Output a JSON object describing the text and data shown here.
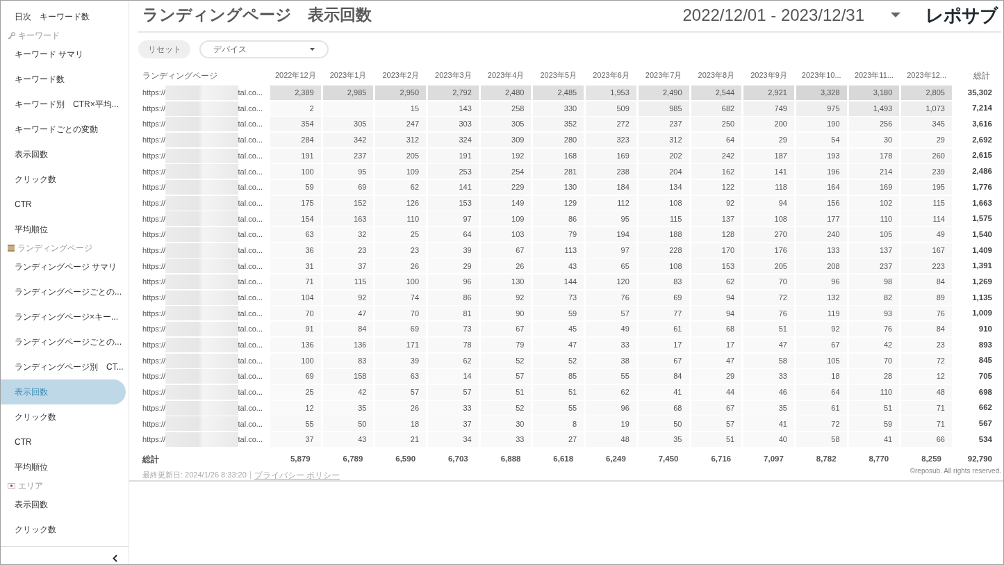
{
  "sidebar": {
    "groups": [
      {
        "items": [
          {
            "label": "日次　キーワード数",
            "selected": false
          }
        ]
      },
      {
        "header": "キーワード",
        "items": [
          {
            "label": "キーワード サマリ",
            "selected": false
          },
          {
            "label": "キーワード数",
            "selected": false
          },
          {
            "label": "キーワード別　CTR×平均...",
            "selected": false
          },
          {
            "label": "キーワードごとの変動",
            "selected": false
          },
          {
            "label": "表示回数",
            "selected": false
          },
          {
            "label": "クリック数",
            "selected": false
          },
          {
            "label": "CTR",
            "selected": false
          },
          {
            "label": "平均順位",
            "selected": false
          }
        ]
      },
      {
        "header": "ランディングページ",
        "items": [
          {
            "label": "ランディングページ サマリ",
            "selected": false
          },
          {
            "label": "ランディングページごとの...",
            "selected": false
          },
          {
            "label": "ランディングページ×キー...",
            "selected": false
          },
          {
            "label": "ランディングページごとの...",
            "selected": false
          },
          {
            "label": "ランディングページ別　CT...",
            "selected": false
          },
          {
            "label": "表示回数",
            "selected": true
          },
          {
            "label": "クリック数",
            "selected": false
          },
          {
            "label": "CTR",
            "selected": false
          },
          {
            "label": "平均順位",
            "selected": false
          }
        ]
      },
      {
        "header": "エリア",
        "items": [
          {
            "label": "表示回数",
            "selected": false
          },
          {
            "label": "クリック数",
            "selected": false
          }
        ]
      }
    ]
  },
  "header": {
    "title": "ランディングページ　表示回数",
    "date_range": "2022/12/01 - 2023/12/31",
    "logo": "レポサブ"
  },
  "filters": {
    "reset_button": "リセット",
    "device_dropdown": {
      "label": "デバイス"
    }
  },
  "table": {
    "columns": [
      "ランディングページ",
      "2022年12月",
      "2023年1月",
      "2023年2月",
      "2023年3月",
      "2023年4月",
      "2023年5月",
      "2023年6月",
      "2023年7月",
      "2023年8月",
      "2023年9月",
      "2023年10...",
      "2023年11...",
      "2023年12...",
      "総計"
    ],
    "rows": [
      {
        "cells": [
          {
            "url_start": "https://",
            "url_end": "tal.co..."
          },
          {
            "value": "2,389"
          },
          {
            "value": "2,985"
          },
          {
            "value": "2,950"
          },
          {
            "value": "2,792"
          },
          {
            "value": "2,480"
          },
          {
            "value": "2,485"
          },
          {
            "value": "1,953"
          },
          {
            "value": "2,490"
          },
          {
            "value": "2,544"
          },
          {
            "value": "2,921"
          },
          {
            "value": "3,328"
          },
          {
            "value": "3,180"
          },
          {
            "value": "2,805"
          },
          {
            "value": "35,302"
          }
        ]
      },
      {
        "cells": [
          {
            "url_start": "https://",
            "url_end": "tal.co..."
          },
          {
            "value": "2"
          },
          {},
          {
            "value": "15"
          },
          {
            "value": "143"
          },
          {
            "value": "258"
          },
          {
            "value": "330"
          },
          {
            "value": "509"
          },
          {
            "value": "985"
          },
          {
            "value": "682"
          },
          {
            "value": "749"
          },
          {
            "value": "975"
          },
          {
            "value": "1,493"
          },
          {
            "value": "1,073"
          },
          {
            "value": "7,214"
          }
        ]
      },
      {
        "cells": [
          {
            "url_start": "https://",
            "url_end": "tal.co..."
          },
          {
            "value": "354"
          },
          {
            "value": "305"
          },
          {
            "value": "247"
          },
          {
            "value": "303"
          },
          {
            "value": "305"
          },
          {
            "value": "352"
          },
          {
            "value": "272"
          },
          {
            "value": "237"
          },
          {
            "value": "250"
          },
          {
            "value": "200"
          },
          {
            "value": "190"
          },
          {
            "value": "256"
          },
          {
            "value": "345"
          },
          {
            "value": "3,616"
          }
        ]
      },
      {
        "cells": [
          {
            "url_start": "https://",
            "url_end": "tal.co..."
          },
          {
            "value": "284"
          },
          {
            "value": "342"
          },
          {
            "value": "312"
          },
          {
            "value": "324"
          },
          {
            "value": "309"
          },
          {
            "value": "280"
          },
          {
            "value": "323"
          },
          {
            "value": "312"
          },
          {
            "value": "64"
          },
          {
            "value": "29"
          },
          {
            "value": "54"
          },
          {
            "value": "30"
          },
          {
            "value": "29"
          },
          {
            "value": "2,692"
          }
        ]
      },
      {
        "cells": [
          {
            "url_start": "https://",
            "url_end": "tal.co..."
          },
          {
            "value": "191"
          },
          {
            "value": "237"
          },
          {
            "value": "205"
          },
          {
            "value": "191"
          },
          {
            "value": "192"
          },
          {
            "value": "168"
          },
          {
            "value": "169"
          },
          {
            "value": "202"
          },
          {
            "value": "242"
          },
          {
            "value": "187"
          },
          {
            "value": "193"
          },
          {
            "value": "178"
          },
          {
            "value": "260"
          },
          {
            "value": "2,615"
          }
        ]
      },
      {
        "cells": [
          {
            "url_start": "https://",
            "url_end": "tal.co..."
          },
          {
            "value": "100"
          },
          {
            "value": "95"
          },
          {
            "value": "109"
          },
          {
            "value": "253"
          },
          {
            "value": "254"
          },
          {
            "value": "281"
          },
          {
            "value": "238"
          },
          {
            "value": "204"
          },
          {
            "value": "162"
          },
          {
            "value": "141"
          },
          {
            "value": "196"
          },
          {
            "value": "214"
          },
          {
            "value": "239"
          },
          {
            "value": "2,486"
          }
        ]
      },
      {
        "cells": [
          {
            "url_start": "https://",
            "url_end": "tal.co..."
          },
          {
            "value": "59"
          },
          {
            "value": "69"
          },
          {
            "value": "62"
          },
          {
            "value": "141"
          },
          {
            "value": "229"
          },
          {
            "value": "130"
          },
          {
            "value": "184"
          },
          {
            "value": "134"
          },
          {
            "value": "122"
          },
          {
            "value": "118"
          },
          {
            "value": "164"
          },
          {
            "value": "169"
          },
          {
            "value": "195"
          },
          {
            "value": "1,776"
          }
        ]
      },
      {
        "cells": [
          {
            "url_start": "https://",
            "url_end": "tal.co..."
          },
          {
            "value": "175"
          },
          {
            "value": "152"
          },
          {
            "value": "126"
          },
          {
            "value": "153"
          },
          {
            "value": "149"
          },
          {
            "value": "129"
          },
          {
            "value": "112"
          },
          {
            "value": "108"
          },
          {
            "value": "92"
          },
          {
            "value": "94"
          },
          {
            "value": "156"
          },
          {
            "value": "102"
          },
          {
            "value": "115"
          },
          {
            "value": "1,663"
          }
        ]
      },
      {
        "cells": [
          {
            "url_start": "https://",
            "url_end": "tal.co..."
          },
          {
            "value": "154"
          },
          {
            "value": "163"
          },
          {
            "value": "110"
          },
          {
            "value": "97"
          },
          {
            "value": "109"
          },
          {
            "value": "86"
          },
          {
            "value": "95"
          },
          {
            "value": "115"
          },
          {
            "value": "137"
          },
          {
            "value": "108"
          },
          {
            "value": "177"
          },
          {
            "value": "110"
          },
          {
            "value": "114"
          },
          {
            "value": "1,575"
          }
        ]
      },
      {
        "cells": [
          {
            "url_start": "https://",
            "url_end": "tal.co..."
          },
          {
            "value": "63"
          },
          {
            "value": "32"
          },
          {
            "value": "25"
          },
          {
            "value": "64"
          },
          {
            "value": "103"
          },
          {
            "value": "79"
          },
          {
            "value": "194"
          },
          {
            "value": "188"
          },
          {
            "value": "128"
          },
          {
            "value": "270"
          },
          {
            "value": "240"
          },
          {
            "value": "105"
          },
          {
            "value": "49"
          },
          {
            "value": "1,540"
          }
        ]
      },
      {
        "cells": [
          {
            "url_start": "https://",
            "url_end": "tal.co..."
          },
          {
            "value": "36"
          },
          {
            "value": "23"
          },
          {
            "value": "23"
          },
          {
            "value": "39"
          },
          {
            "value": "67"
          },
          {
            "value": "113"
          },
          {
            "value": "97"
          },
          {
            "value": "228"
          },
          {
            "value": "170"
          },
          {
            "value": "176"
          },
          {
            "value": "133"
          },
          {
            "value": "137"
          },
          {
            "value": "167"
          },
          {
            "value": "1,409"
          }
        ]
      },
      {
        "cells": [
          {
            "url_start": "https://",
            "url_end": "tal.co..."
          },
          {
            "value": "31"
          },
          {
            "value": "37"
          },
          {
            "value": "26"
          },
          {
            "value": "29"
          },
          {
            "value": "26"
          },
          {
            "value": "43"
          },
          {
            "value": "65"
          },
          {
            "value": "108"
          },
          {
            "value": "153"
          },
          {
            "value": "205"
          },
          {
            "value": "208"
          },
          {
            "value": "237"
          },
          {
            "value": "223"
          },
          {
            "value": "1,391"
          }
        ]
      },
      {
        "cells": [
          {
            "url_start": "https://",
            "url_end": "tal.co..."
          },
          {
            "value": "71"
          },
          {
            "value": "115"
          },
          {
            "value": "100"
          },
          {
            "value": "96"
          },
          {
            "value": "130"
          },
          {
            "value": "144"
          },
          {
            "value": "120"
          },
          {
            "value": "83"
          },
          {
            "value": "62"
          },
          {
            "value": "70"
          },
          {
            "value": "96"
          },
          {
            "value": "98"
          },
          {
            "value": "84"
          },
          {
            "value": "1,269"
          }
        ]
      },
      {
        "cells": [
          {
            "url_start": "https://",
            "url_end": "tal.co..."
          },
          {
            "value": "104"
          },
          {
            "value": "92"
          },
          {
            "value": "74"
          },
          {
            "value": "86"
          },
          {
            "value": "92"
          },
          {
            "value": "73"
          },
          {
            "value": "76"
          },
          {
            "value": "69"
          },
          {
            "value": "94"
          },
          {
            "value": "72"
          },
          {
            "value": "132"
          },
          {
            "value": "82"
          },
          {
            "value": "89"
          },
          {
            "value": "1,135"
          }
        ]
      },
      {
        "cells": [
          {
            "url_start": "https://",
            "url_end": "tal.co..."
          },
          {
            "value": "70"
          },
          {
            "value": "47"
          },
          {
            "value": "70"
          },
          {
            "value": "81"
          },
          {
            "value": "90"
          },
          {
            "value": "59"
          },
          {
            "value": "57"
          },
          {
            "value": "77"
          },
          {
            "value": "94"
          },
          {
            "value": "76"
          },
          {
            "value": "119"
          },
          {
            "value": "93"
          },
          {
            "value": "76"
          },
          {
            "value": "1,009"
          }
        ]
      },
      {
        "cells": [
          {
            "url_start": "https://",
            "url_end": "tal.co..."
          },
          {
            "value": "91"
          },
          {
            "value": "84"
          },
          {
            "value": "69"
          },
          {
            "value": "73"
          },
          {
            "value": "67"
          },
          {
            "value": "45"
          },
          {
            "value": "49"
          },
          {
            "value": "61"
          },
          {
            "value": "68"
          },
          {
            "value": "51"
          },
          {
            "value": "92"
          },
          {
            "value": "76"
          },
          {
            "value": "84"
          },
          {
            "value": "910"
          }
        ]
      },
      {
        "cells": [
          {
            "url_start": "https://",
            "url_end": "tal.co..."
          },
          {
            "value": "136"
          },
          {
            "value": "136"
          },
          {
            "value": "171"
          },
          {
            "value": "78"
          },
          {
            "value": "79"
          },
          {
            "value": "47"
          },
          {
            "value": "33"
          },
          {
            "value": "17"
          },
          {
            "value": "17"
          },
          {
            "value": "47"
          },
          {
            "value": "67"
          },
          {
            "value": "42"
          },
          {
            "value": "23"
          },
          {
            "value": "893"
          }
        ]
      },
      {
        "cells": [
          {
            "url_start": "https://",
            "url_end": "tal.co..."
          },
          {
            "value": "100"
          },
          {
            "value": "83"
          },
          {
            "value": "39"
          },
          {
            "value": "62"
          },
          {
            "value": "52"
          },
          {
            "value": "52"
          },
          {
            "value": "38"
          },
          {
            "value": "67"
          },
          {
            "value": "47"
          },
          {
            "value": "58"
          },
          {
            "value": "105"
          },
          {
            "value": "70"
          },
          {
            "value": "72"
          },
          {
            "value": "845"
          }
        ]
      },
      {
        "cells": [
          {
            "url_start": "https://",
            "url_end": "tal.co..."
          },
          {
            "value": "69"
          },
          {
            "value": "158"
          },
          {
            "value": "63"
          },
          {
            "value": "14"
          },
          {
            "value": "57"
          },
          {
            "value": "85"
          },
          {
            "value": "55"
          },
          {
            "value": "84"
          },
          {
            "value": "29"
          },
          {
            "value": "33"
          },
          {
            "value": "18"
          },
          {
            "value": "28"
          },
          {
            "value": "12"
          },
          {
            "value": "705"
          }
        ]
      },
      {
        "cells": [
          {
            "url_start": "https://",
            "url_end": "tal.co..."
          },
          {
            "value": "25"
          },
          {
            "value": "42"
          },
          {
            "value": "57"
          },
          {
            "value": "57"
          },
          {
            "value": "51"
          },
          {
            "value": "51"
          },
          {
            "value": "62"
          },
          {
            "value": "41"
          },
          {
            "value": "44"
          },
          {
            "value": "46"
          },
          {
            "value": "64"
          },
          {
            "value": "110"
          },
          {
            "value": "48"
          },
          {
            "value": "698"
          }
        ]
      },
      {
        "cells": [
          {
            "url_start": "https://",
            "url_end": "tal.co..."
          },
          {
            "value": "12"
          },
          {
            "value": "35"
          },
          {
            "value": "26"
          },
          {
            "value": "33"
          },
          {
            "value": "52"
          },
          {
            "value": "55"
          },
          {
            "value": "96"
          },
          {
            "value": "68"
          },
          {
            "value": "67"
          },
          {
            "value": "35"
          },
          {
            "value": "61"
          },
          {
            "value": "51"
          },
          {
            "value": "71"
          },
          {
            "value": "662"
          }
        ]
      },
      {
        "cells": [
          {
            "url_start": "https://",
            "url_end": "tal.co..."
          },
          {
            "value": "55"
          },
          {
            "value": "50"
          },
          {
            "value": "18"
          },
          {
            "value": "37"
          },
          {
            "value": "30"
          },
          {
            "value": "8"
          },
          {
            "value": "19"
          },
          {
            "value": "50"
          },
          {
            "value": "57"
          },
          {
            "value": "41"
          },
          {
            "value": "72"
          },
          {
            "value": "59"
          },
          {
            "value": "71"
          },
          {
            "value": "567"
          }
        ]
      },
      {
        "cells": [
          {
            "url_start": "https://",
            "url_end": "tal.co..."
          },
          {
            "value": "37"
          },
          {
            "value": "43"
          },
          {
            "value": "21"
          },
          {
            "value": "34"
          },
          {
            "value": "33"
          },
          {
            "value": "27"
          },
          {
            "value": "48"
          },
          {
            "value": "35"
          },
          {
            "value": "51"
          },
          {
            "value": "40"
          },
          {
            "value": "58"
          },
          {
            "value": "41"
          },
          {
            "value": "66"
          },
          {
            "value": "534"
          }
        ]
      }
    ],
    "totals_row": {
      "cells": [
        "総計",
        "5,879",
        "6,789",
        "6,590",
        "6,703",
        "6,888",
        "6,618",
        "6,249",
        "7,450",
        "6,716",
        "7,097",
        "8,782",
        "8,770",
        "8,259",
        "92,790"
      ]
    }
  },
  "footer": {
    "last_updated": "最終更新日: 2024/1/26 8:33:20",
    "privacy_link": "プライバシー ポリシー",
    "copyright": "©reposub. All rights reserved."
  }
}
